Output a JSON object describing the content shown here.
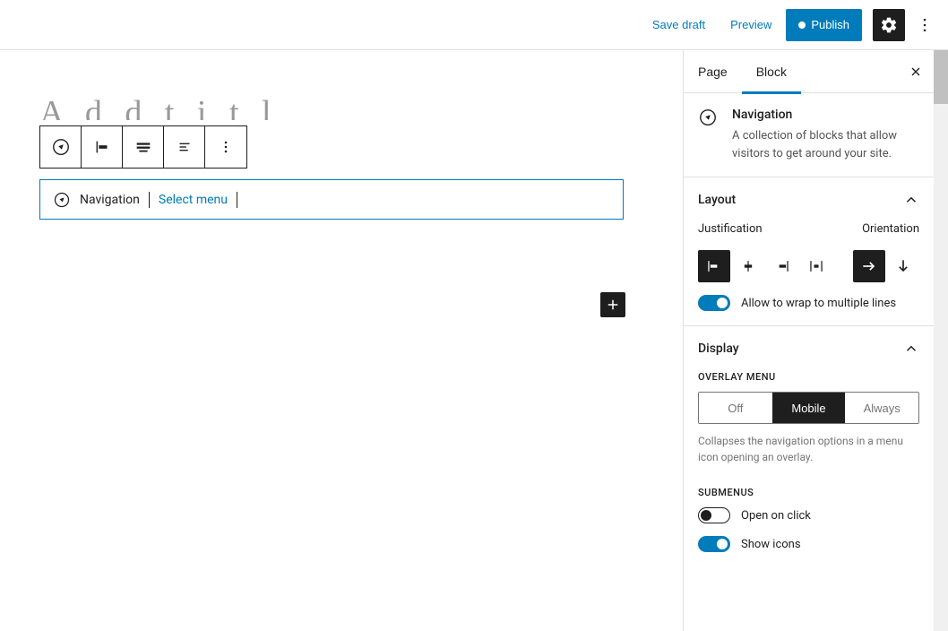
{
  "topbar": {
    "save_draft": "Save draft",
    "preview": "Preview",
    "publish": "Publish"
  },
  "canvas": {
    "title_placeholder": "A d d t i t l",
    "nav_block_label": "Navigation",
    "select_menu": "Select menu"
  },
  "sidebar": {
    "tabs": {
      "page": "Page",
      "block": "Block"
    },
    "block_info": {
      "title": "Navigation",
      "description": "A collection of blocks that allow visitors to get around your site."
    },
    "layout": {
      "title": "Layout",
      "justification_label": "Justification",
      "orientation_label": "Orientation",
      "wrap_label": "Allow to wrap to multiple lines"
    },
    "display": {
      "title": "Display",
      "overlay_heading": "OVERLAY MENU",
      "overlay_options": {
        "off": "Off",
        "mobile": "Mobile",
        "always": "Always"
      },
      "overlay_help": "Collapses the navigation options in a menu icon opening an overlay.",
      "submenus_heading": "SUBMENUS",
      "open_on_click": "Open on click",
      "show_icons": "Show icons"
    }
  }
}
